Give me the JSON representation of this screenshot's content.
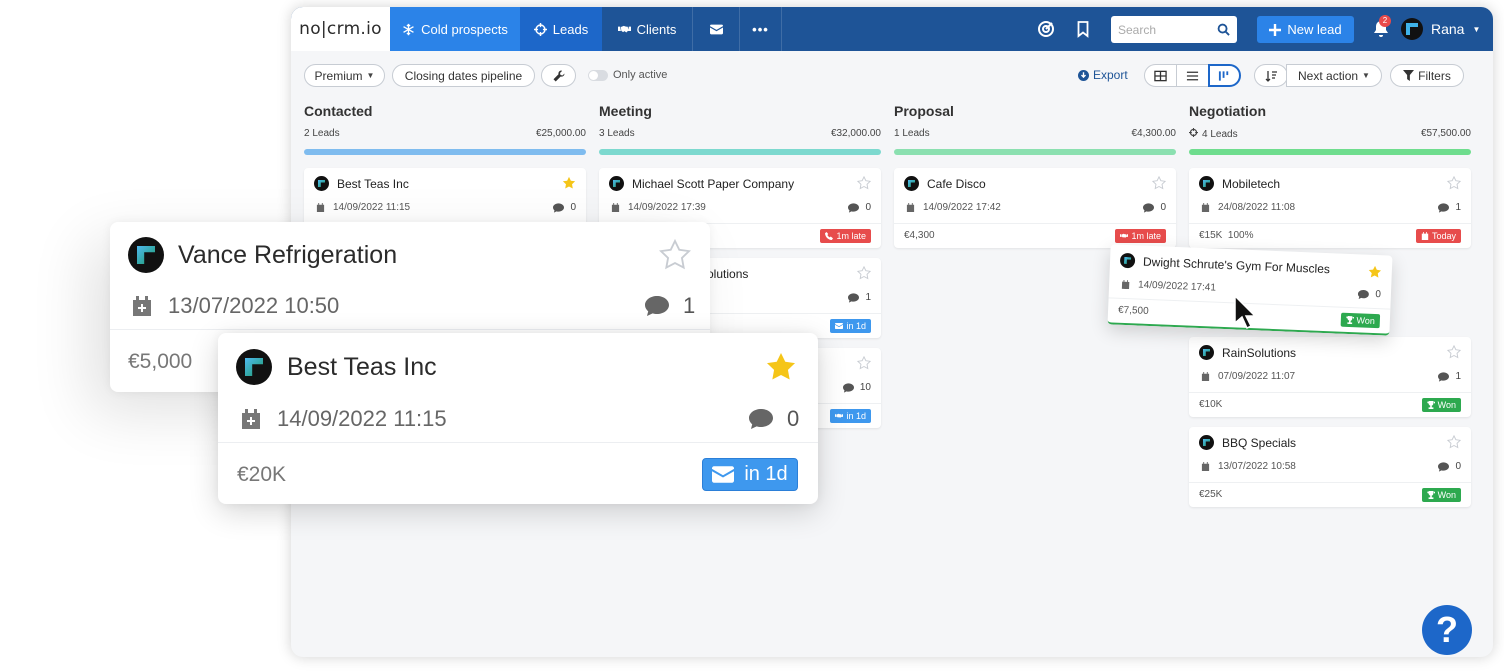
{
  "navbar": {
    "logo": "no|crm.io",
    "tabs": [
      {
        "label": "Cold prospects",
        "icon": "snowflake-icon"
      },
      {
        "label": "Leads",
        "icon": "crosshair-icon"
      },
      {
        "label": "Clients",
        "icon": "handshake-icon"
      },
      {
        "label": "",
        "icon": "envelope-icon"
      },
      {
        "label": "•••",
        "icon": "more-icon"
      }
    ],
    "search_placeholder": "Search",
    "new_lead_label": "New lead",
    "notification_count": "2",
    "user_name": "Rana",
    "colors": {
      "navbar": "#1e5497",
      "active_tab": "#2b83e8",
      "accent": "#2b83e8"
    }
  },
  "toolbar": {
    "premium_label": "Premium",
    "pipeline_label": "Closing dates pipeline",
    "only_active_label": "Only active",
    "export_label": "Export",
    "next_action_label": "Next action",
    "filters_label": "Filters"
  },
  "columns": [
    {
      "title": "Contacted",
      "count": "2 Leads",
      "total": "€25,000.00",
      "bar_color": "#7fbcef",
      "cards": [
        {
          "name": "Best Teas Inc",
          "date": "14/09/2022 11:15",
          "comments": "0",
          "starred": true
        }
      ]
    },
    {
      "title": "Meeting",
      "count": "3 Leads",
      "total": "€32,000.00",
      "bar_color": "#7dd9cf",
      "cards": [
        {
          "name": "Michael Scott Paper Company",
          "date": "14/09/2022 17:39",
          "comments": "0",
          "amount": "",
          "badge": "1m late",
          "badge_color": "#e74c4c",
          "starred": false
        },
        {
          "name": "olutions",
          "date": "",
          "comments": "1",
          "amount": "",
          "badge": "in 1d",
          "badge_color": "#3e98ee",
          "starred": false
        },
        {
          "name": "",
          "date": "",
          "comments": "10",
          "amount": "",
          "badge": "in 1d",
          "badge_color": "#3e98ee",
          "starred": false
        }
      ]
    },
    {
      "title": "Proposal",
      "count": "1 Leads",
      "total": "€4,300.00",
      "bar_color": "#8be0b0",
      "cards": [
        {
          "name": "Cafe Disco",
          "date": "14/09/2022 17:42",
          "comments": "0",
          "amount": "€4,300",
          "badge": "1m late",
          "badge_color": "#e74c4c",
          "starred": false
        }
      ]
    },
    {
      "title": "Negotiation",
      "count": "4 Leads",
      "total": "€57,500.00",
      "bar_color": "#6fdd8e",
      "cards": [
        {
          "name": "Mobiletech",
          "date": "24/08/2022 11:08",
          "comments": "1",
          "amount": "€15K  100%",
          "badge": "Today",
          "badge_color": "#e74c4c",
          "starred": false
        },
        {
          "name": "RainSolutions",
          "date": "07/09/2022 11:07",
          "comments": "1",
          "amount": "€10K",
          "badge": "Won",
          "badge_color": "#2da94f",
          "starred": false
        },
        {
          "name": "BBQ Specials",
          "date": "13/07/2022 10:58",
          "comments": "0",
          "amount": "€25K",
          "badge": "Won",
          "badge_color": "#2da94f",
          "starred": false
        }
      ]
    }
  ],
  "dragged_card": {
    "name": "Dwight Schrute's Gym For Muscles",
    "date": "14/09/2022 17:41",
    "comments": "0",
    "amount": "€7,500",
    "badge": "Won",
    "starred": true
  },
  "floating_cards": {
    "vance": {
      "name": "Vance Refrigeration",
      "date": "13/07/2022 10:50",
      "comments": "1",
      "amount": "€5,000",
      "starred": false
    },
    "best_teas": {
      "name": "Best Teas Inc",
      "date": "14/09/2022 11:15",
      "comments": "0",
      "amount": "€20K",
      "badge": "in 1d",
      "starred": true
    }
  },
  "help_label": "?"
}
